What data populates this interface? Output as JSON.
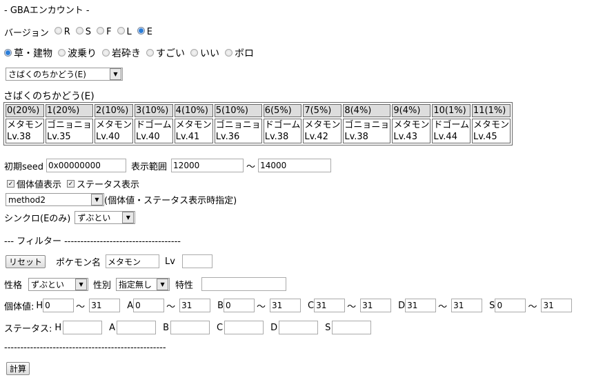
{
  "title": "- GBAエンカウント -",
  "version": {
    "label": "バージョン",
    "options": [
      "R",
      "S",
      "F",
      "L",
      "E"
    ],
    "selected": "E"
  },
  "method": {
    "options": [
      "草・建物",
      "波乗り",
      "岩砕き",
      "すごい",
      "いい",
      "ボロ"
    ],
    "selected": "草・建物"
  },
  "location_select": "さばくのちかどう(E)",
  "location_title": "さばくのちかどう(E)",
  "table": {
    "slots": [
      {
        "h": "0(20%)",
        "name": "メタモン",
        "lv": "Lv.38"
      },
      {
        "h": "1(20%)",
        "name": "ゴニョニョ",
        "lv": "Lv.35"
      },
      {
        "h": "2(10%)",
        "name": "メタモン",
        "lv": "Lv.40"
      },
      {
        "h": "3(10%)",
        "name": "ドゴーム",
        "lv": "Lv.40"
      },
      {
        "h": "4(10%)",
        "name": "メタモン",
        "lv": "Lv.41"
      },
      {
        "h": "5(10%)",
        "name": "ゴニョニョ",
        "lv": "Lv.36"
      },
      {
        "h": "6(5%)",
        "name": "ドゴーム",
        "lv": "Lv.38"
      },
      {
        "h": "7(5%)",
        "name": "メタモン",
        "lv": "Lv.42"
      },
      {
        "h": "8(4%)",
        "name": "ゴニョニョ",
        "lv": "Lv.38"
      },
      {
        "h": "9(4%)",
        "name": "メタモン",
        "lv": "Lv.43"
      },
      {
        "h": "10(1%)",
        "name": "ドゴーム",
        "lv": "Lv.44"
      },
      {
        "h": "11(1%)",
        "name": "メタモン",
        "lv": "Lv.45"
      }
    ]
  },
  "seed": {
    "label": "初期seed",
    "value": "0x00000000",
    "range_label": "表示範囲",
    "from": "12000",
    "tilde": "～",
    "to": "14000"
  },
  "checks": {
    "iv": "個体値表示",
    "status": "ステータス表示"
  },
  "rng_method": {
    "value": "method2",
    "note": "(個体値・ステータス表示時指定)"
  },
  "sync": {
    "label": "シンクロ(Eのみ)",
    "value": "ずぶとい"
  },
  "filter_title": "---  フィルター  ------------------------------------",
  "filter": {
    "reset": "リセット",
    "pokemon_label": "ポケモン名",
    "pokemon": "メタモン",
    "lv_label": "Lv",
    "lv": "",
    "nature_label": "性格",
    "nature": "ずぶとい",
    "gender_label": "性別",
    "gender": "指定無し",
    "ability_label": "特性",
    "ability": "",
    "iv_label": "個体値:",
    "iv": [
      {
        "k": "H",
        "min": "0",
        "max": "31"
      },
      {
        "k": "A",
        "min": "0",
        "max": "31"
      },
      {
        "k": "B",
        "min": "0",
        "max": "31"
      },
      {
        "k": "C",
        "min": "31",
        "max": "31"
      },
      {
        "k": "D",
        "min": "31",
        "max": "31"
      },
      {
        "k": "S",
        "min": "0",
        "max": "31"
      }
    ],
    "stat_label": "ステータス:",
    "stats": [
      "H",
      "A",
      "B",
      "C",
      "D",
      "S"
    ]
  },
  "bottom_line": "--------------------------------------------------",
  "calc": "計算"
}
